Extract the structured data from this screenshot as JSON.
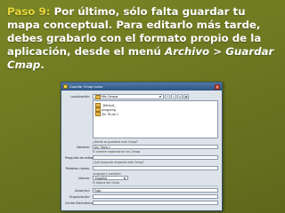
{
  "slide": {
    "step_label": "Paso 9:",
    "text_part1": "Por último, sólo falta guardar tu mapa conceptual. Para editarlo más tarde, debes grabarlo con el formato propio de la aplicación, desde el menú ",
    "menu_path": "Archivo > Guardar Cmap",
    "text_end": "."
  },
  "dialog": {
    "title": "Guardar Cmap como",
    "close_glyph": "×",
    "location_label": "Localización:",
    "location_value": "Mis Cmaps",
    "files": [
      "_Default_",
      "pingpong",
      "Sin Título 1"
    ],
    "name_label": "Nombre:",
    "name_value": "Sin Título 1",
    "name_hint_top": "¿Dónde se guardará este Cmap?",
    "name_hint_bottom": "El nombre mostrado en los Cmaps",
    "focus_label": "Pregunta de enfoque:",
    "focus_hint": "¿Qué pregunta responde este Cmap?",
    "keywords_label": "Palabras claves:",
    "keywords_hint": "Lenguaje y contexto",
    "language_label": "Idioma:",
    "language_value": "Español",
    "language_hint": "El idioma del Cmap",
    "author_label": "Autor(es):",
    "author_value": "Yuan",
    "org_label": "Organización:",
    "email_label": "Correo Electrónico:"
  }
}
